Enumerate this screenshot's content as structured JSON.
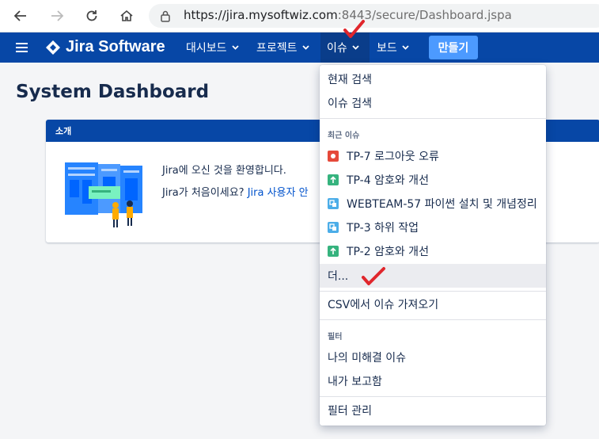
{
  "browser": {
    "url_host": "https://jira.mysoftwiz.com",
    "url_path": ":8443/secure/Dashboard.jspa"
  },
  "header": {
    "logo_text": "Jira Software",
    "menus": [
      "대시보드",
      "프로젝트",
      "이슈",
      "보드"
    ],
    "create_label": "만들기"
  },
  "page": {
    "title": "System Dashboard"
  },
  "gadget": {
    "title": "소개",
    "welcome": "Jira에 오신 것을 환영합니다.",
    "first_time": "Jira가 처음이세요?",
    "guide_link": "Jira 사용자 안"
  },
  "dropdown": {
    "current_search": "현재 검색",
    "issue_search": "이슈 검색",
    "recent_section": "최근 이슈",
    "recent_issues": [
      {
        "label": "TP-7 로그아웃 오류",
        "type": "bug"
      },
      {
        "label": "TP-4 암호와 개선",
        "type": "improvement"
      },
      {
        "label": "WEBTEAM-57 파이썬 설치 및 개념정리",
        "type": "subtask"
      },
      {
        "label": "TP-3 하위 작업",
        "type": "subtask"
      },
      {
        "label": "TP-2 암호와 개선",
        "type": "improvement"
      }
    ],
    "more": "더...",
    "csv_import": "CSV에서 이슈 가져오기",
    "filter_section": "필터",
    "my_open": "나의 미해결 이슈",
    "reported_by_me": "내가 보고함",
    "manage_filters": "필터 관리"
  },
  "colors": {
    "header": "#0747a6",
    "create": "#4c9aff",
    "bug": "#e5493a",
    "improvement": "#36b37e",
    "subtask": "#4bade8",
    "checkmark": "#e0262c"
  }
}
